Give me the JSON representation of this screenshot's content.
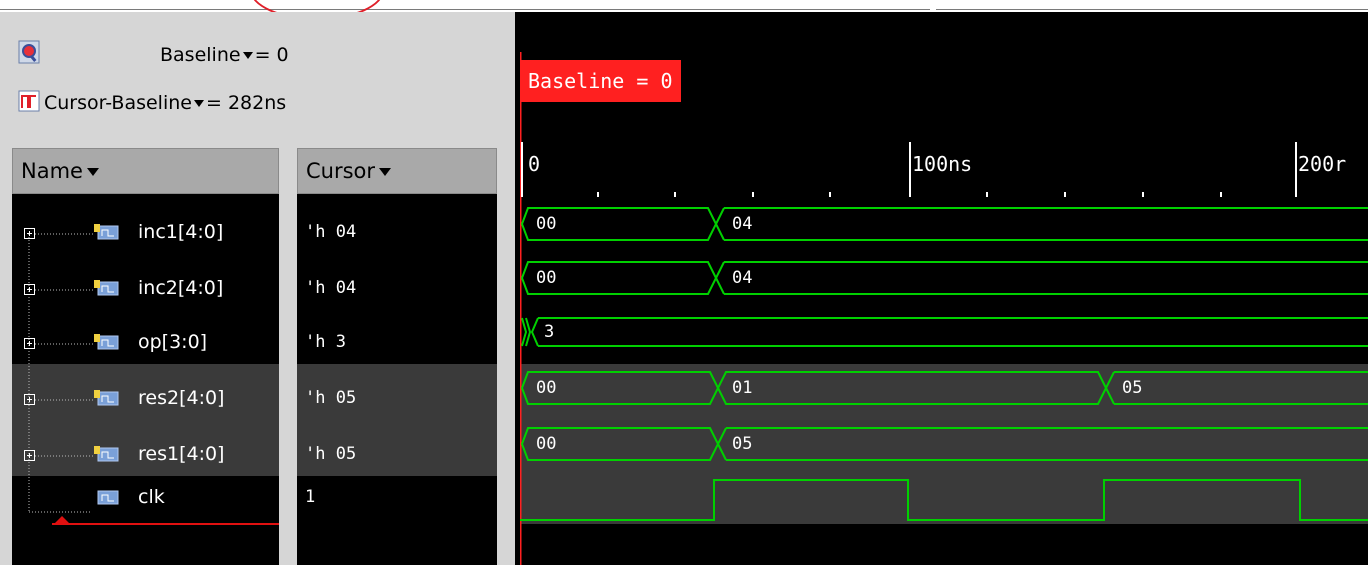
{
  "toolbar": {
    "baseline_label": "Baseline",
    "baseline_value": "= 0",
    "cursor_baseline_label": "Cursor-Baseline",
    "cursor_baseline_value": "= 282ns"
  },
  "columns": {
    "name_header": "Name",
    "cursor_header": "Cursor"
  },
  "waveform": {
    "baseline_tag": "Baseline = 0",
    "ticks": [
      "0",
      "100ns",
      "200r"
    ]
  },
  "signals": [
    {
      "name": "inc1[4:0]",
      "cursor_value": "'h 04",
      "segments": [
        "00",
        "04"
      ]
    },
    {
      "name": "inc2[4:0]",
      "cursor_value": "'h 04",
      "segments": [
        "00",
        "04"
      ]
    },
    {
      "name": "op[3:0]",
      "cursor_value": "'h 3",
      "segments": [
        "3"
      ]
    },
    {
      "name": "res2[4:0]",
      "cursor_value": "'h 05",
      "segments": [
        "00",
        "01",
        "05"
      ]
    },
    {
      "name": "res1[4:0]",
      "cursor_value": "'h 05",
      "segments": [
        "00",
        "05"
      ]
    },
    {
      "name": "clk",
      "cursor_value": "1",
      "segments": []
    }
  ],
  "colors": {
    "wave": "#00d000",
    "baseline": "#ff2020",
    "panel": "#d6d6d6",
    "selected_row": "#3a3a3a"
  },
  "icons": [
    "zoom-icon",
    "cursor-baseline-icon",
    "expand-icon",
    "bus-signal-icon",
    "signal-icon"
  ]
}
